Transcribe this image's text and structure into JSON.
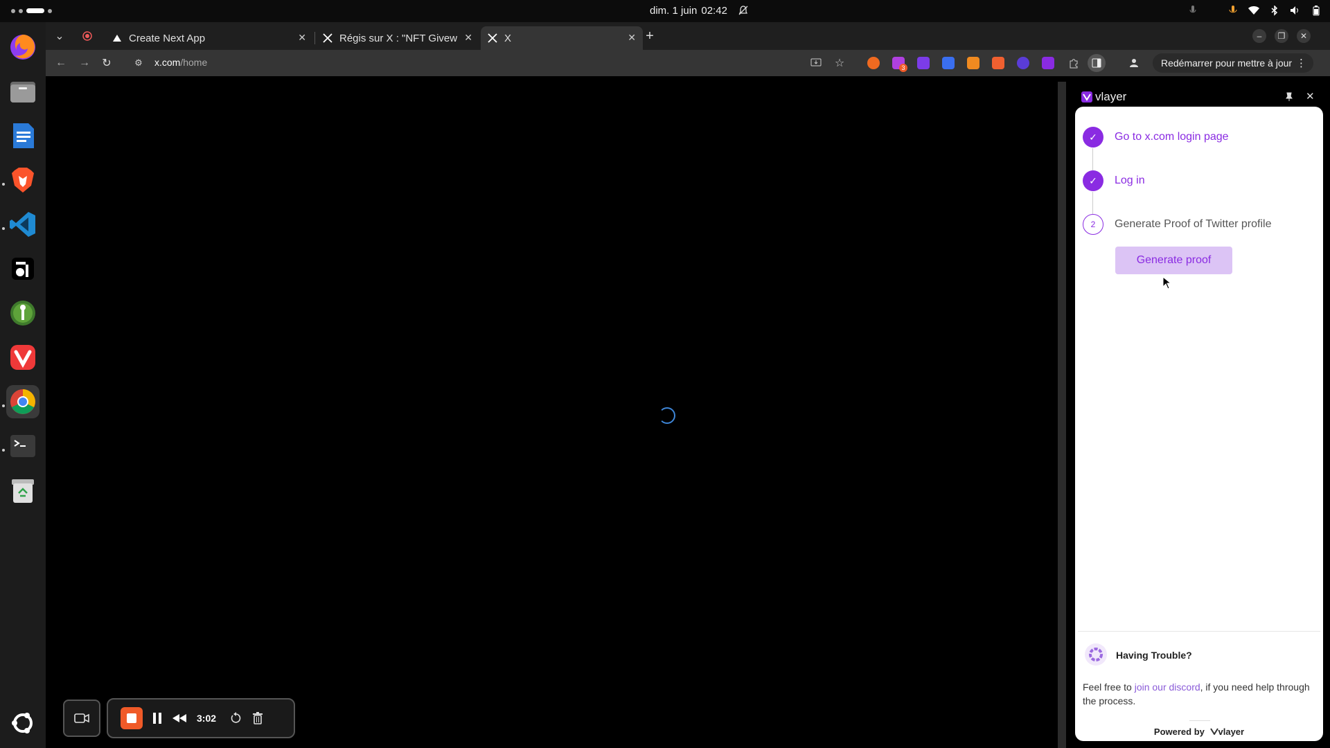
{
  "system": {
    "date": "dim. 1 juin",
    "time": "02:42"
  },
  "dock": {
    "items": [
      {
        "name": "firefox"
      },
      {
        "name": "files"
      },
      {
        "name": "writer"
      },
      {
        "name": "brave"
      },
      {
        "name": "vscode"
      },
      {
        "name": "anytype"
      },
      {
        "name": "keepass"
      },
      {
        "name": "vivaldi"
      },
      {
        "name": "chrome"
      },
      {
        "name": "terminal"
      },
      {
        "name": "trash"
      }
    ]
  },
  "browser": {
    "tabs": [
      {
        "title": "Create Next App"
      },
      {
        "title": "Régis sur X : \"NFT Givew"
      },
      {
        "title": "X"
      }
    ],
    "url": {
      "domain": "x.com",
      "path": "/home"
    },
    "update_label": "Redémarrer pour mettre à jour",
    "extension_badge": "3"
  },
  "recorder": {
    "time": "3:02"
  },
  "side_panel": {
    "title": "vlayer",
    "steps": [
      {
        "label": "Go to x.com login page",
        "status": "done"
      },
      {
        "label": "Log in",
        "status": "done"
      },
      {
        "label": "Generate Proof of Twitter profile",
        "status": "pending",
        "number": "2"
      }
    ],
    "generate_button": "Generate proof",
    "trouble": {
      "title": "Having Trouble?",
      "text_before": "Feel free to ",
      "link": "join our discord",
      "text_after": ", if you need help through the process."
    },
    "powered_by": "Powered by",
    "brand": "vlayer"
  }
}
